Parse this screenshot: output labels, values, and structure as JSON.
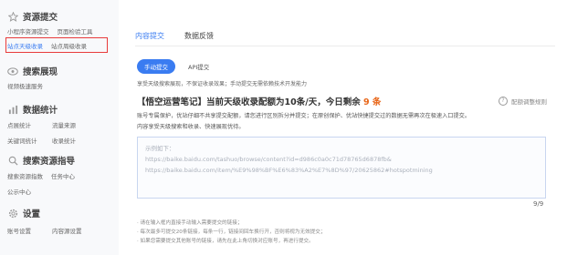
{
  "sidebar": {
    "groups": [
      {
        "title": "资源提交",
        "icon": "star-icon",
        "rows": [
          [
            "小程序资源提交",
            "页面检验工具"
          ],
          [
            "站点天级收录",
            "站点周级收录"
          ]
        ]
      },
      {
        "title": "搜索展现",
        "icon": "eye-icon",
        "rows": [
          [
            "视频极速服务"
          ]
        ]
      },
      {
        "title": "数据统计",
        "icon": "chart-icon",
        "rows": [
          [
            "点展统计",
            "流量来源"
          ],
          [
            "关键词统计",
            "收录统计"
          ]
        ]
      },
      {
        "title": "搜索资源指导",
        "icon": "search-icon",
        "rows": [
          [
            "搜索资源指数",
            "任务中心"
          ],
          [
            "公示中心"
          ]
        ]
      },
      {
        "title": "设置",
        "icon": "gear-icon",
        "rows": [
          [
            "账号设置",
            "内容源设置"
          ]
        ]
      }
    ]
  },
  "main": {
    "tabs": [
      "内容提交",
      "数据反馈"
    ],
    "modes": [
      "手动提交",
      "API提交"
    ],
    "description": "享受天级搜索展现，不保证收录效果；手动提交无需依赖技术开发能力",
    "heading_prefix": "【悟空运营笔记】当前天级收录配额为10条/天，今日剩余",
    "heading_remaining": "9 条",
    "rule_link": "配额调整规则",
    "notes": [
      "账号专属保护，优站仔细不共享提交配额，请您进行区别拆分并提交；在原创保护、优站快捷提交过的数据无需再次在极速入口提交。",
      "内容享受天级搜索和收录、快速展现优待。"
    ],
    "textarea": {
      "label": "示例如下：",
      "lines": [
        "https://baike.baidu.com/tashuo/browse/content?id=d986c0a0c71d78765d6878fb&",
        "https://baike.baidu.com/item/%E9%98%BF%E6%83%A2%E7%8D%97/20625862#hotspotmining"
      ]
    },
    "counter": "9/9",
    "tips": [
      "· 请在输入框内直接手动输入需要提交的链接；",
      "· 每次最多可提交20条链接，每条一行，链接间回车换行开，否则将视为无效提交；",
      "· 如果您需要提交其他账号的链接，请先在此上角切换对应账号，再进行提交。"
    ]
  },
  "colors": {
    "accent": "#3a7cf1",
    "highlight_border": "#e83b3b",
    "remaining": "#e8671a"
  }
}
